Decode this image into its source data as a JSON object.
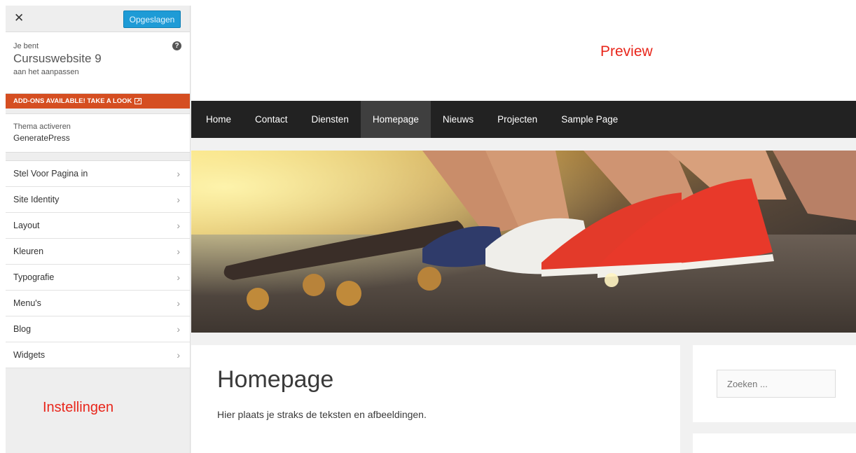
{
  "sidebar": {
    "close_icon": "close-icon",
    "save_label": "Opgeslagen",
    "info": {
      "prefix": "Je bent",
      "site_name": "Cursuswebsite 9",
      "suffix": "aan het aanpassen"
    },
    "addons_banner": "ADD-ONS AVAILABLE! TAKE A LOOK",
    "theme": {
      "label": "Thema activeren",
      "name": "GeneratePress"
    },
    "items": [
      {
        "label": "Stel Voor Pagina in"
      },
      {
        "label": "Site Identity"
      },
      {
        "label": "Layout"
      },
      {
        "label": "Kleuren"
      },
      {
        "label": "Typografie"
      },
      {
        "label": "Menu's"
      },
      {
        "label": "Blog"
      },
      {
        "label": "Widgets"
      }
    ],
    "annotation": "Instellingen"
  },
  "preview": {
    "annotation": "Preview",
    "nav": [
      {
        "label": "Home"
      },
      {
        "label": "Contact"
      },
      {
        "label": "Diensten"
      },
      {
        "label": "Homepage"
      },
      {
        "label": "Nieuws"
      },
      {
        "label": "Projecten"
      },
      {
        "label": "Sample Page"
      }
    ],
    "active_nav": "Homepage",
    "page_title": "Homepage",
    "page_text": "Hier plaats je straks de teksten en afbeeldingen.",
    "search_placeholder": "Zoeken ..."
  },
  "colors": {
    "save_button": "#1e9bd6",
    "addons_banner": "#d54e21",
    "nav_bg": "#222222",
    "nav_active": "#3f3f3f",
    "annotation": "#e8261b"
  }
}
